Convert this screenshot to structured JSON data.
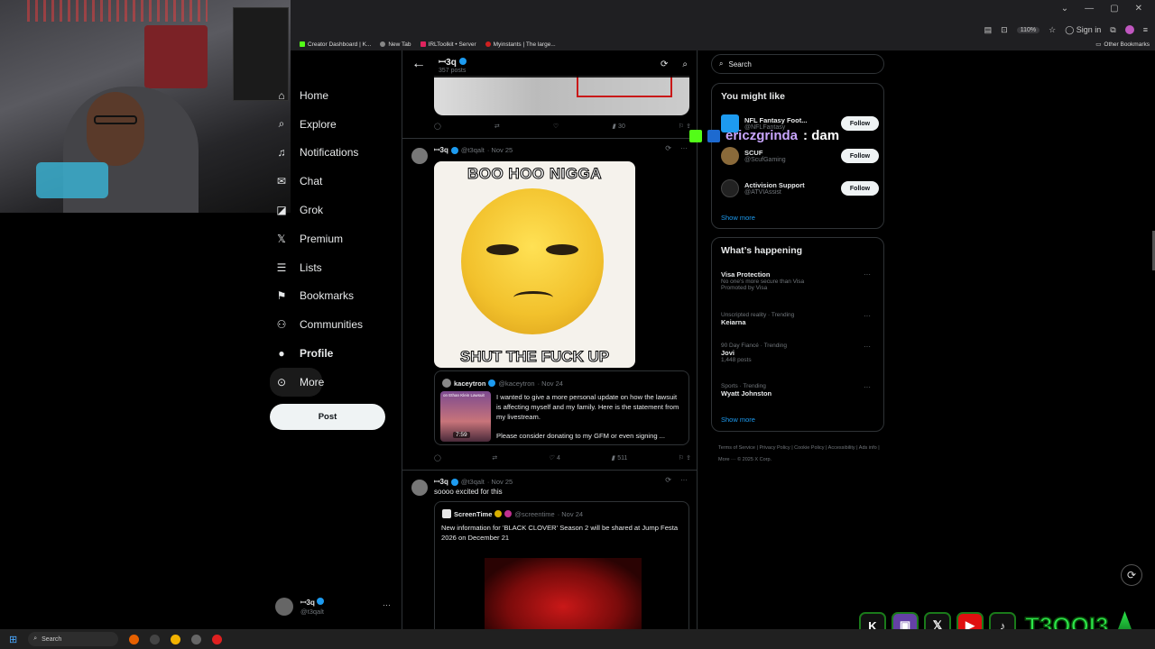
{
  "browser": {
    "zoom": "110%",
    "sign_in": "Sign in",
    "bookmarks": [
      {
        "label": "Creator Dashboard | K...",
        "color": "#53fc18"
      },
      {
        "label": "New Tab",
        "color": "#888888"
      },
      {
        "label": "IRLToolkit • Server",
        "color": "#e0245e"
      },
      {
        "label": "Myinstants | The large...",
        "color": "#d02020"
      }
    ],
    "other_bookmarks": "Other Bookmarks"
  },
  "nav": {
    "items": [
      {
        "label": "Home",
        "icon": "home-icon"
      },
      {
        "label": "Explore",
        "icon": "search-icon"
      },
      {
        "label": "Notifications",
        "icon": "bell-icon"
      },
      {
        "label": "Chat",
        "icon": "mail-icon"
      },
      {
        "label": "Grok",
        "icon": "grok-icon"
      },
      {
        "label": "Premium",
        "icon": "x-logo-icon"
      },
      {
        "label": "Lists",
        "icon": "list-icon"
      },
      {
        "label": "Bookmarks",
        "icon": "bookmark-icon"
      },
      {
        "label": "Communities",
        "icon": "people-icon"
      },
      {
        "label": "Profile",
        "icon": "person-icon"
      },
      {
        "label": "More",
        "icon": "more-circle-icon"
      }
    ],
    "post_button": "Post",
    "account": {
      "name": "ꟷ3q",
      "handle": "@t3qalt"
    }
  },
  "timeline": {
    "header": {
      "name": "ꟷ3q",
      "subtitle": "357 posts"
    },
    "first_actions": {
      "views": "30"
    },
    "tweet1": {
      "name": "ꟷ3q",
      "handle": "@t3qalt",
      "date": "· Nov 25",
      "meme_top": "BOO HOO NIGGA",
      "meme_bottom": "SHUT THE FUCK UP",
      "quote": {
        "name": "kaceytron",
        "handle": "@kaceytron",
        "date": "· Nov 24",
        "thumb_caption": "on Ethan Klein Lawsuit",
        "duration": "7:59",
        "text": "I wanted to give a more personal update on how the lawsuit is affecting myself and my family. Here is the statement from my livestream.",
        "text2": "Please consider donating to my GFM or even signing ..."
      },
      "likes": "4",
      "views": "511"
    },
    "tweet2": {
      "name": "ꟷ3q",
      "handle": "@t3qalt",
      "date": "· Nov 25",
      "text": "soooo excited for this",
      "quote": {
        "name": "ScreenTime",
        "handle": "@screentime",
        "date": "· Nov 24",
        "text": "New information for 'BLACK CLOVER' Season 2 will be shared at Jump Festa 2026 on December 21"
      }
    }
  },
  "right": {
    "search_placeholder": "Search",
    "you_might_like": {
      "title": "You might like",
      "items": [
        {
          "name": "NFL Fantasy Foot...",
          "handle": "@NFLFantasy",
          "color": "#1d9bf0",
          "follow": "Follow"
        },
        {
          "name": "SCUF",
          "handle": "@ScufGaming",
          "color": "#8a6a3a",
          "follow": "Follow"
        },
        {
          "name": "Activision Support",
          "handle": "@ATVIAssist",
          "color": "#222222",
          "follow": "Follow"
        }
      ],
      "show_more": "Show more"
    },
    "whats_happening": {
      "title": "What’s happening",
      "trends": [
        {
          "name": "Visa Protection",
          "context": "",
          "extra": "No one's more secure than Visa",
          "extra2": "Promoted by Visa"
        },
        {
          "context": "Unscripted reality · Trending",
          "name": "Keiarna",
          "extra": "",
          "extra2": ""
        },
        {
          "context": "90 Day Fiancé · Trending",
          "name": "Jovi",
          "extra": "1,448 posts",
          "extra2": ""
        },
        {
          "context": "Sports · Trending",
          "name": "Wyatt Johnston",
          "extra": "",
          "extra2": ""
        }
      ],
      "show_more": "Show more"
    },
    "footer": "Terms of Service | Privacy Policy | Cookie Policy | Accessibility | Ads info | More ··· © 2025 X Corp."
  },
  "overlay": {
    "chat_user": "ericzgrinda",
    "chat_msg": ": dam",
    "channel_name": "T3QQI3"
  },
  "taskbar": {
    "search": "Search"
  }
}
